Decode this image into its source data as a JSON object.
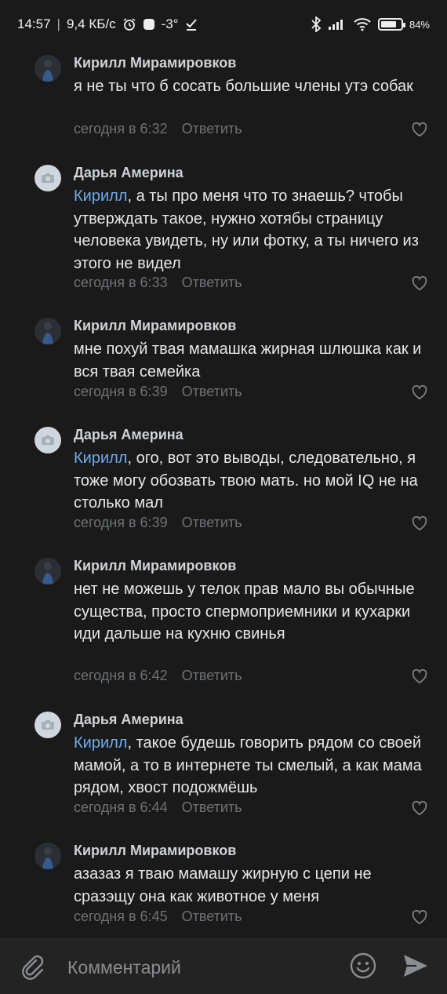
{
  "status_bar": {
    "time": "14:57",
    "speed": "9,4 КБ/с",
    "temperature": "-3°",
    "battery": "84%",
    "battery_level": 0.84
  },
  "comments": [
    {
      "author": "Кирилл Мирамировков",
      "mention": "",
      "text": "я не ты что б сосать большие члены утэ собак",
      "time": "сегодня в 6:32",
      "reply": "Ответить"
    },
    {
      "author": "Дарья Америна",
      "mention": "Кирилл",
      "text": ", а ты про меня что то знаешь? чтобы утверждать такое, нужно хотябы страницу человека увидеть, ну или фотку, а ты ничего из этого не видел",
      "time": "сегодня в 6:33",
      "reply": "Ответить"
    },
    {
      "author": "Кирилл Мирамировков",
      "mention": "",
      "text": "мне похуй твая мамашка жирная шлюшка как и вся твая семейка",
      "time": "сегодня в 6:39",
      "reply": "Ответить"
    },
    {
      "author": "Дарья Америна",
      "mention": "Кирилл",
      "text": ", ого, вот это выводы, следовательно, я тоже могу обозвать твою мать. но мой IQ не на столько мал",
      "time": "сегодня в 6:39",
      "reply": "Ответить"
    },
    {
      "author": "Кирилл Мирамировков",
      "mention": "",
      "text": "нет не можешь у телок прав мало вы обычные существа, просто спермоприемники и кухарки иди дальше на кухню свинья",
      "time": "сегодня в 6:42",
      "reply": "Ответить"
    },
    {
      "author": "Дарья Америна",
      "mention": "Кирилл",
      "text": ", такое будешь говорить рядом со своей мамой, а то в интернете ты смелый, а как мама рядом, хвост подожмёшь",
      "time": "сегодня в 6:44",
      "reply": "Ответить"
    },
    {
      "author": "Кирилл Мирамировков",
      "mention": "",
      "text": "азазаз я тваю мамашу жирную с цепи не сразэщу она как животное у меня",
      "time": "сегодня в 6:45",
      "reply": "Ответить"
    }
  ],
  "composer": {
    "placeholder": "Комментарий"
  },
  "icons": {
    "attach": "paperclip-icon",
    "emoji": "smiley-icon",
    "send": "send-icon",
    "like": "heart-icon",
    "avatar_placeholder": "camera-icon"
  },
  "colors": {
    "background": "#1a1a1a",
    "mention": "#71aaeb",
    "meta": "#6f7276"
  }
}
